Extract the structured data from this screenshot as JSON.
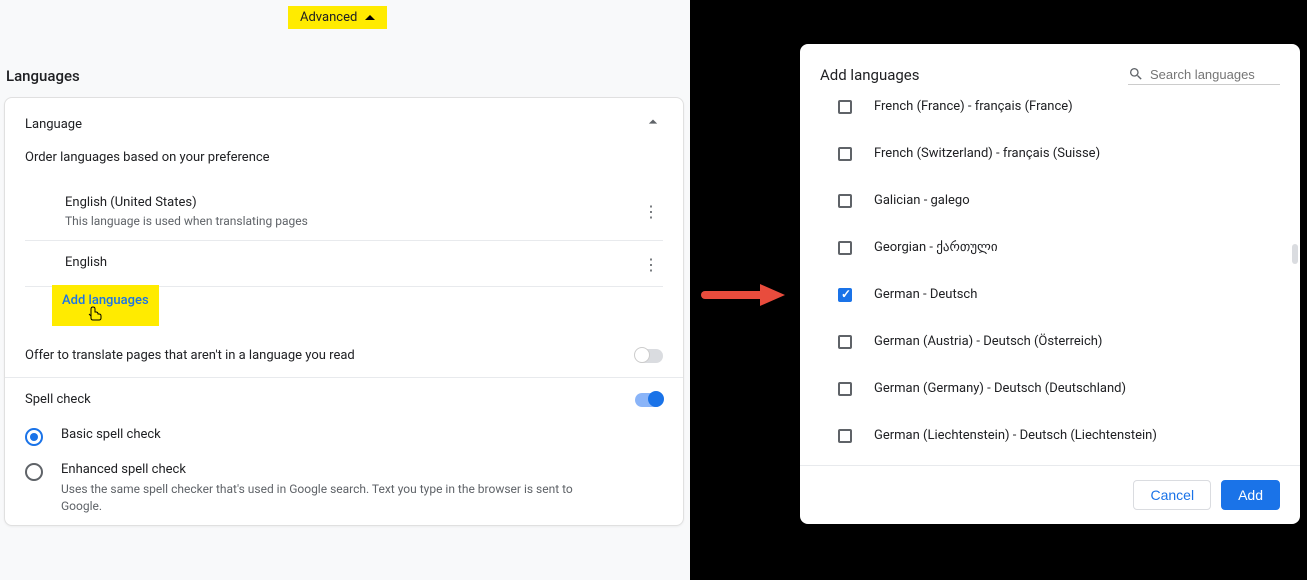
{
  "advanced_label": "Advanced",
  "section_title": "Languages",
  "card": {
    "header": "Language",
    "order_text": "Order languages based on your preference",
    "languages": [
      {
        "title": "English (United States)",
        "sub": "This language is used when translating pages"
      },
      {
        "title": "English",
        "sub": ""
      }
    ],
    "add_label": "Add languages",
    "translate_label": "Offer to translate pages that aren't in a language you read",
    "spell_label": "Spell check",
    "basic": {
      "title": "Basic spell check",
      "sub": ""
    },
    "enhanced": {
      "title": "Enhanced spell check",
      "sub": "Uses the same spell checker that's used in Google search. Text you type in the browser is sent to Google."
    }
  },
  "dialog": {
    "title": "Add languages",
    "search_placeholder": "Search languages",
    "options": [
      {
        "label": "French (France) - français (France)",
        "checked": false
      },
      {
        "label": "French (Switzerland) - français (Suisse)",
        "checked": false
      },
      {
        "label": "Galician - galego",
        "checked": false
      },
      {
        "label": "Georgian - ქართული",
        "checked": false
      },
      {
        "label": "German - Deutsch",
        "checked": true
      },
      {
        "label": "German (Austria) - Deutsch (Österreich)",
        "checked": false
      },
      {
        "label": "German (Germany) - Deutsch (Deutschland)",
        "checked": false
      },
      {
        "label": "German (Liechtenstein) - Deutsch (Liechtenstein)",
        "checked": false
      }
    ],
    "cancel_label": "Cancel",
    "add_label": "Add"
  }
}
